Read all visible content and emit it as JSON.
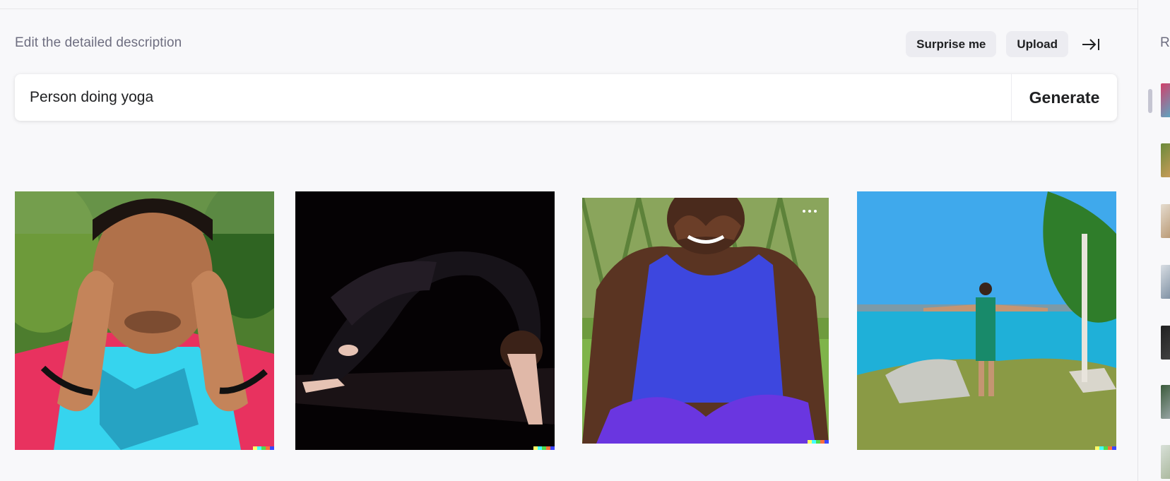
{
  "header": {
    "hint": "Edit the detailed description",
    "surprise_label": "Surprise me",
    "upload_label": "Upload"
  },
  "prompt": {
    "value": "Person doing yoga",
    "generate_label": "Generate"
  },
  "results": {
    "images": [
      {
        "subject": "man with hands at temples, cyan shirt, trees"
      },
      {
        "subject": "person in black doing backbend on dark background"
      },
      {
        "subject": "smiling man in blue tank top, hands over eyes, sitting on grass"
      },
      {
        "subject": "man with outstretched arms on rocky shore facing sea"
      }
    ]
  },
  "sidebar": {
    "title": "R"
  },
  "colors": {
    "background": "#f8f8fa",
    "pill": "#ececf1",
    "hint_text": "#6e6e80",
    "signature": [
      "#ffff66",
      "#42ffff",
      "#51da4c",
      "#ff6e3c",
      "#3c46ff"
    ]
  },
  "icons": {
    "collapse": "arrow-right-to-bar-icon",
    "more": "more-horizontal-icon"
  }
}
